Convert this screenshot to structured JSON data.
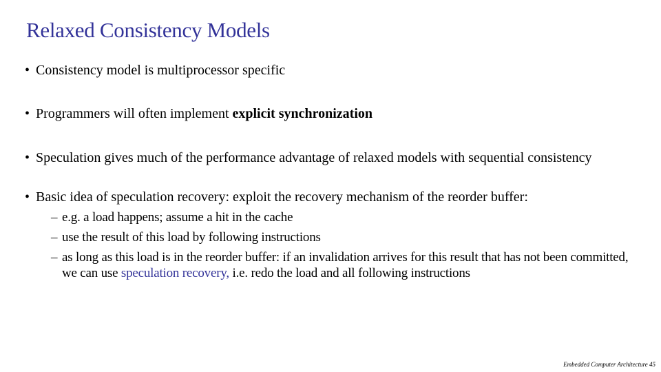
{
  "slide": {
    "title": "Relaxed Consistency Models",
    "bullets": [
      {
        "marker": "•",
        "text": "Consistency model is multiprocessor specific"
      },
      {
        "marker": "•",
        "pre": "Programmers will often implement ",
        "bold": "explicit synchronization"
      },
      {
        "marker": "•",
        "text": "Speculation gives much of the performance advantage of relaxed models with sequential consistency"
      },
      {
        "marker": "•",
        "text": "Basic idea of speculation recovery: exploit the recovery mechanism of the reorder buffer:"
      }
    ],
    "subbullets": [
      {
        "marker": "–",
        "text": "e.g. a load happens; assume a hit in the cache"
      },
      {
        "marker": "–",
        "text": "use the result of this load by following instructions"
      },
      {
        "marker": "–",
        "pre": "as long as this load is in the reorder buffer: if an invalidation arrives for this result that has not been committed, we can use ",
        "highlight": "speculation recovery,",
        "post": " i.e. redo the load and all following instructions"
      }
    ],
    "highlight_color": "#333399"
  },
  "footer": {
    "text": "Embedded Computer Architecture",
    "page": "45"
  }
}
